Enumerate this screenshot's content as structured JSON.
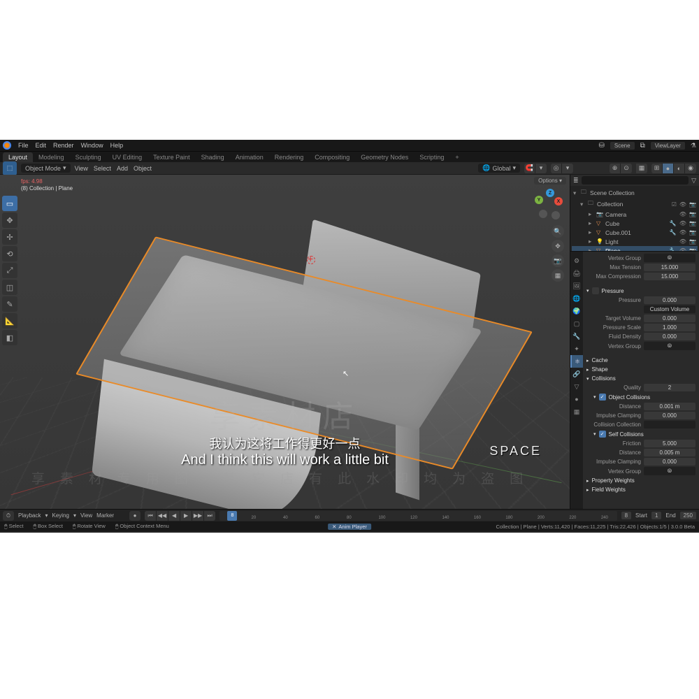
{
  "topmenu": {
    "file": "File",
    "edit": "Edit",
    "render": "Render",
    "window": "Window",
    "help": "Help"
  },
  "scene_label": "Scene",
  "viewlayer_label": "ViewLayer",
  "workspaces": [
    "Layout",
    "Modeling",
    "Sculpting",
    "UV Editing",
    "Texture Paint",
    "Shading",
    "Animation",
    "Rendering",
    "Compositing",
    "Geometry Nodes",
    "Scripting",
    "+"
  ],
  "workspace_active": "Layout",
  "header": {
    "mode": "Object Mode",
    "menus": [
      "View",
      "Select",
      "Add",
      "Object"
    ],
    "orient": "Global",
    "options": "Options"
  },
  "viewport": {
    "frame_label": "fps: 4.98",
    "obj_label": "(8) Collection | Plane"
  },
  "outliner": {
    "root": "Scene Collection",
    "collection": "Collection",
    "items": [
      {
        "name": "Camera",
        "icon": "cam"
      },
      {
        "name": "Cube",
        "icon": "mesh"
      },
      {
        "name": "Cube.001",
        "icon": "mesh"
      },
      {
        "name": "Light",
        "icon": "light"
      },
      {
        "name": "Plane",
        "icon": "mesh",
        "selected": true
      }
    ]
  },
  "props": {
    "vertex_group": "Vertex Group",
    "max_tension_label": "Max Tension",
    "max_tension": "15.000",
    "max_compression_label": "Max Compression",
    "max_compression": "15.000",
    "pressure_section": "Pressure",
    "pressure_label": "Pressure",
    "pressure": "0.000",
    "custom_volume": "Custom Volume",
    "target_volume_label": "Target Volume",
    "target_volume": "0.000",
    "pressure_scale_label": "Pressure Scale",
    "pressure_scale": "1.000",
    "fluid_density_label": "Fluid Density",
    "fluid_density": "0.000",
    "cache": "Cache",
    "shape": "Shape",
    "collisions": "Collisions",
    "quality_label": "Quality",
    "quality": "2",
    "obj_collisions": "Object Collisions",
    "distance_label": "Distance",
    "distance": "0.001 m",
    "impulse_clamping_label": "Impulse Clamping",
    "impulse_clamping": "0.000",
    "collision_collection": "Collision Collection",
    "self_collisions": "Self Collisions",
    "friction_label": "Friction",
    "friction": "5.000",
    "self_distance": "0.005 m",
    "property_weights": "Property Weights",
    "field_weights": "Field Weights"
  },
  "timeline": {
    "menu": [
      "Playback",
      "Keying",
      "View",
      "Marker"
    ],
    "current": "8",
    "ticks": [
      "20",
      "40",
      "60",
      "80",
      "100",
      "120",
      "140",
      "160",
      "180",
      "200",
      "220",
      "240"
    ],
    "start_label": "Start",
    "start": "1",
    "end_label": "End",
    "end": "250"
  },
  "statusbar": {
    "items": [
      "Select",
      "Box Select",
      "Rotate View",
      "Object Context Menu"
    ],
    "anim": "Anim Player",
    "right": "Collection | Plane | Verts:11,420 | Faces:11,225 | Tris:22,426 | Objects:1/5 | 3.0.0 Beta"
  },
  "watermark_big": "享素材店",
  "watermark_line": "享素材专用图·其它店有此水印均为盗图",
  "subtitle_cn": "我认为这将工作得更好一点",
  "subtitle_en": "And I think this will work a little bit",
  "key_hint": "SPACE"
}
